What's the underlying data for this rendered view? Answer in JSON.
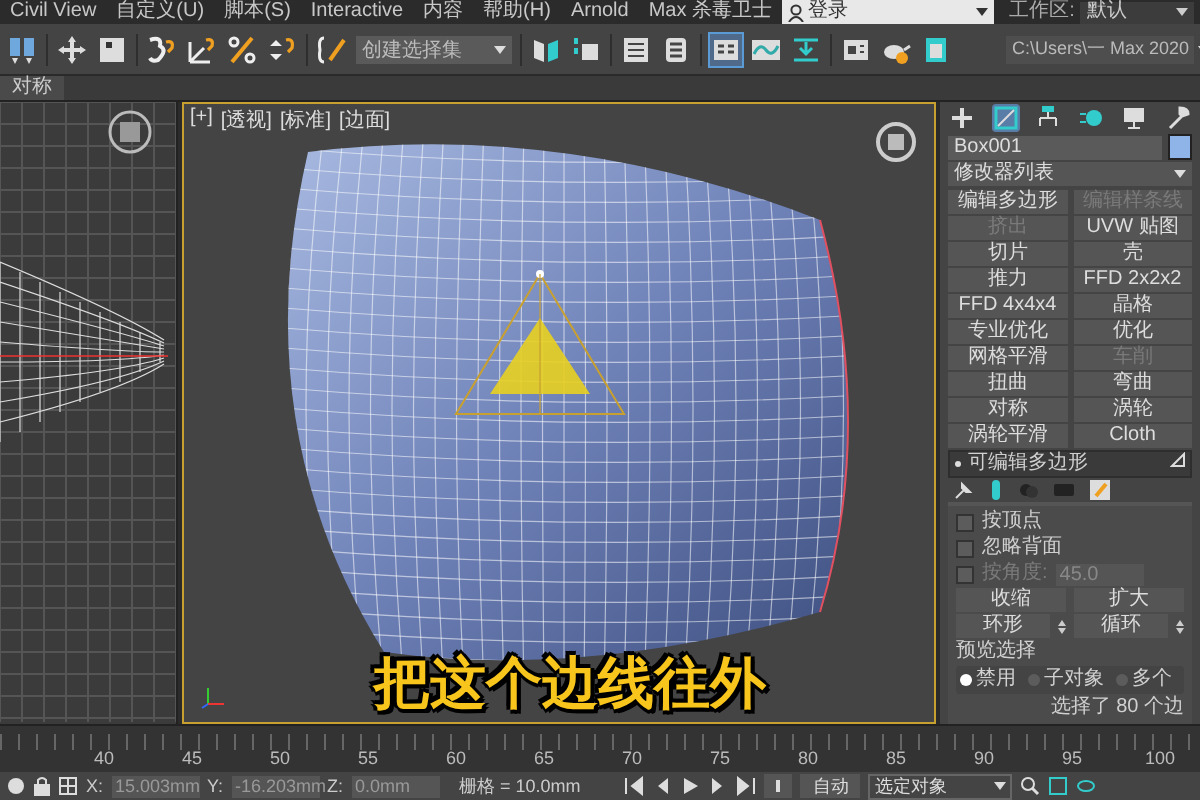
{
  "menu_bar": {
    "items": [
      "Civil View",
      "自定义(U)",
      "脚本(S)",
      "Interactive",
      "内容",
      "帮助(H)",
      "Arnold",
      "Max 杀毒卫士"
    ],
    "login": "登录",
    "workspace_label": "工作区:",
    "workspace": "默认"
  },
  "toolbar": {
    "selection_set": "创建选择集",
    "project_path": "C:\\Users\\一 Max 2020"
  },
  "ribbon": {
    "tab": "对称"
  },
  "viewport": {
    "labels": [
      "[+]",
      "[透视]",
      "[标准]",
      "[边面]"
    ]
  },
  "command_panel": {
    "tabs": [
      {
        "kind": "create",
        "selected": false
      },
      {
        "kind": "modify",
        "selected": true
      },
      {
        "kind": "hierarchy",
        "selected": false
      },
      {
        "kind": "motion",
        "selected": false
      },
      {
        "kind": "display",
        "selected": false
      },
      {
        "kind": "utilities",
        "selected": false
      }
    ],
    "object_name": "Box001",
    "modifier_list": "修改器列表",
    "modifiers": [
      {
        "label": "编辑多边形",
        "disabled": false
      },
      {
        "label": "编辑样条线",
        "disabled": true
      },
      {
        "label": "挤出",
        "disabled": true
      },
      {
        "label": "UVW 贴图",
        "disabled": false
      },
      {
        "label": "切片",
        "disabled": false
      },
      {
        "label": "壳",
        "disabled": false
      },
      {
        "label": "推力",
        "disabled": false
      },
      {
        "label": "FFD 2x2x2",
        "disabled": false
      },
      {
        "label": "FFD 4x4x4",
        "disabled": false
      },
      {
        "label": "晶格",
        "disabled": false
      },
      {
        "label": "专业优化",
        "disabled": false
      },
      {
        "label": "优化",
        "disabled": false
      },
      {
        "label": "网格平滑",
        "disabled": false
      },
      {
        "label": "车削",
        "disabled": true
      },
      {
        "label": "扭曲",
        "disabled": false
      },
      {
        "label": "弯曲",
        "disabled": false
      },
      {
        "label": "对称",
        "disabled": false
      },
      {
        "label": "涡轮",
        "disabled": false
      },
      {
        "label": "涡轮平滑",
        "disabled": false
      },
      {
        "label": "Cloth",
        "disabled": false
      }
    ],
    "stack_item": "可编辑多边形",
    "selection": {
      "checkboxes": [
        {
          "label": "按顶点",
          "checked": false,
          "disabled": false
        },
        {
          "label": "忽略背面",
          "checked": false,
          "disabled": false
        },
        {
          "label": "按角度:",
          "checked": false,
          "disabled": true
        }
      ],
      "angle": "45.0",
      "buttons": [
        "收缩",
        "扩大"
      ],
      "spinner_buttons": [
        "环形",
        "循环"
      ],
      "preview_label": "预览选择",
      "preview_options": [
        {
          "label": "禁用",
          "selected": true
        },
        {
          "label": "子对象",
          "selected": false
        },
        {
          "label": "多个",
          "selected": false
        }
      ],
      "status": "选择了 80 个边"
    }
  },
  "timeline": {
    "ticks": [
      "40",
      "45",
      "50",
      "55",
      "60",
      "65",
      "70",
      "75",
      "80",
      "85",
      "90",
      "95",
      "100"
    ]
  },
  "status_bar": {
    "coords": [
      {
        "label": "X:",
        "value": "15.003mm"
      },
      {
        "label": "Y:",
        "value": "-16.203mm"
      },
      {
        "label": "Z:",
        "value": "0.0mm"
      }
    ],
    "grid": "栅格 = 10.0mm",
    "auto_key": "自动",
    "key_filter": "选定对象"
  },
  "subtitle": "把这个边线往外"
}
